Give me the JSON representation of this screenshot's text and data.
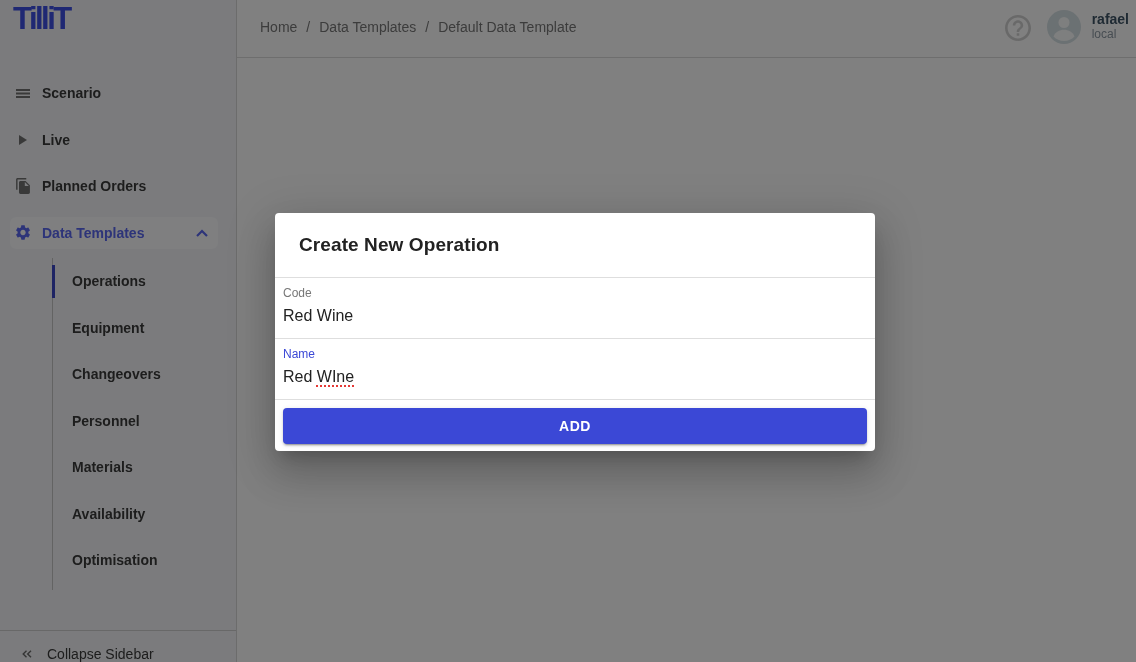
{
  "logo": {
    "text": "TilliT"
  },
  "sidebar": {
    "items": [
      {
        "label": "Scenario",
        "kind": "link",
        "selected": false
      },
      {
        "label": "Live",
        "kind": "link",
        "selected": false
      },
      {
        "label": "Planned Orders",
        "kind": "link",
        "selected": false
      },
      {
        "label": "Data Templates",
        "kind": "group",
        "selected": true,
        "expanded": true,
        "children": [
          {
            "label": "Operations",
            "selected": true
          },
          {
            "label": "Equipment",
            "selected": false
          },
          {
            "label": "Changeovers",
            "selected": false
          },
          {
            "label": "Personnel",
            "selected": false
          },
          {
            "label": "Materials",
            "selected": false
          },
          {
            "label": "Availability",
            "selected": false
          },
          {
            "label": "Optimisation",
            "selected": false
          }
        ]
      }
    ],
    "collapse": {
      "label": "Collapse Sidebar"
    }
  },
  "header": {
    "breadcrumbs": [
      {
        "label": "Home",
        "separator": "/"
      },
      {
        "label": "Data Templates",
        "separator": "/"
      },
      {
        "label": "Default Data Template"
      }
    ],
    "user": {
      "name": "rafael",
      "subtitle": "local"
    }
  },
  "dialog": {
    "backdrop": true,
    "title": "Create New Operation",
    "fields": [
      {
        "label": "Code",
        "value": "Red Wine",
        "focused": false,
        "misspelled": false
      },
      {
        "label": "Name",
        "value": "Red WIne",
        "focused": true,
        "misspelled": true
      }
    ],
    "button": "ADD"
  }
}
